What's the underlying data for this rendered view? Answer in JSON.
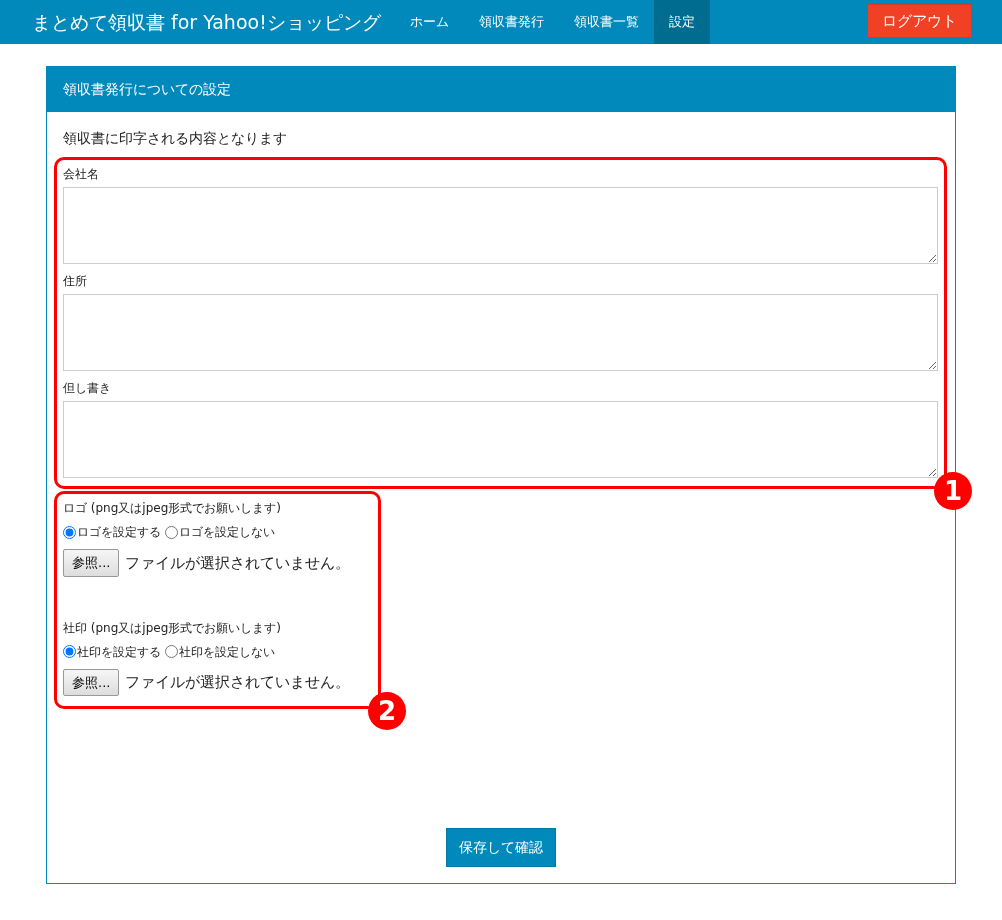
{
  "navbar": {
    "brand": "まとめて領収書 for Yahoo!ショッピング",
    "items": [
      {
        "label": "ホーム",
        "selected": false
      },
      {
        "label": "領収書発行",
        "selected": false
      },
      {
        "label": "領収書一覧",
        "selected": false
      },
      {
        "label": "設定",
        "selected": true
      }
    ],
    "logout": "ログアウト"
  },
  "panel": {
    "title": "領収書発行についての設定",
    "intro": "領収書に印字される内容となります"
  },
  "text_fields": [
    {
      "label": "会社名"
    },
    {
      "label": "住所"
    },
    {
      "label": "但し書き"
    }
  ],
  "image_fields": [
    {
      "label": "ロゴ (png又はjpeg形式でお願いします)",
      "options": [
        {
          "label": "ロゴを設定する",
          "selected": true
        },
        {
          "label": "ロゴを設定しない",
          "selected": false
        }
      ],
      "browse_button": "参照...",
      "file_status": "ファイルが選択されていません。"
    },
    {
      "label": "社印 (png又はjpeg形式でお願いします)",
      "options": [
        {
          "label": "社印を設定する",
          "selected": true
        },
        {
          "label": "社印を設定しない",
          "selected": false
        }
      ],
      "browse_button": "参照...",
      "file_status": "ファイルが選択されていません。"
    }
  ],
  "callouts": [
    {
      "number": "1"
    },
    {
      "number": "2"
    }
  ],
  "save_button": "保存して確認"
}
